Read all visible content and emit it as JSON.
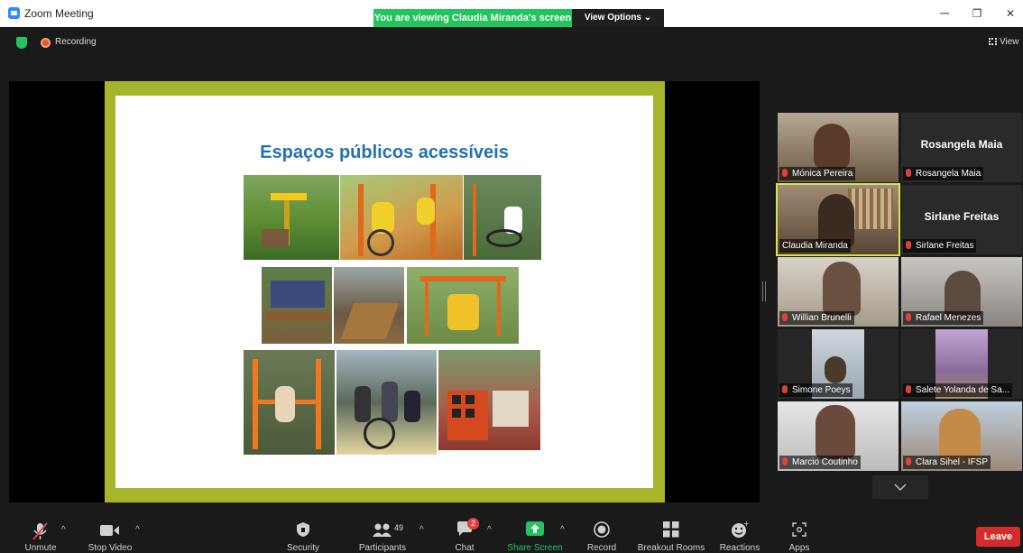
{
  "window": {
    "title": "Zoom Meeting",
    "banner": "You are viewing Claudia Miranda's screen",
    "view_options": "View Options",
    "minimize": "─",
    "restore": "❐",
    "close": "✕"
  },
  "status": {
    "recording": "Recording",
    "view_label": "View"
  },
  "slide": {
    "title": "Espaços públicos acessíveis",
    "frame_color": "#a7b52d"
  },
  "participants": {
    "tiles": [
      {
        "name": "Mónica Pereira",
        "video": true
      },
      {
        "name": "Rosangela Maia",
        "video": false,
        "display_name": "Rosangela Maia"
      },
      {
        "name": "Claudia Miranda",
        "video": true,
        "active_speaker": true
      },
      {
        "name": "Sirlane Freitas",
        "video": false,
        "display_name": "Sirlane Freitas"
      },
      {
        "name": "Willian Brunelli",
        "video": true
      },
      {
        "name": "Rafael Menezes",
        "video": true
      },
      {
        "name": "Simone Poeys",
        "video": true
      },
      {
        "name": "Salete Yolanda de Sa...",
        "video": true
      },
      {
        "name": "Marcio Coutinho",
        "video": true
      },
      {
        "name": "Clara Sihel - IFSP",
        "video": true
      }
    ]
  },
  "toolbar": {
    "unmute": "Unmute",
    "stop_video": "Stop Video",
    "security": "Security",
    "participants": "Participants",
    "participants_count": "49",
    "chat": "Chat",
    "chat_badge": "2",
    "share_screen": "Share Screen",
    "record": "Record",
    "breakout_rooms": "Breakout Rooms",
    "reactions": "Reactions",
    "apps": "Apps",
    "leave": "Leave"
  },
  "colors": {
    "share_green": "#21c45d",
    "leave_red": "#d62b2b",
    "active_outline": "#d6e54a",
    "muted_red": "#e0413a"
  }
}
